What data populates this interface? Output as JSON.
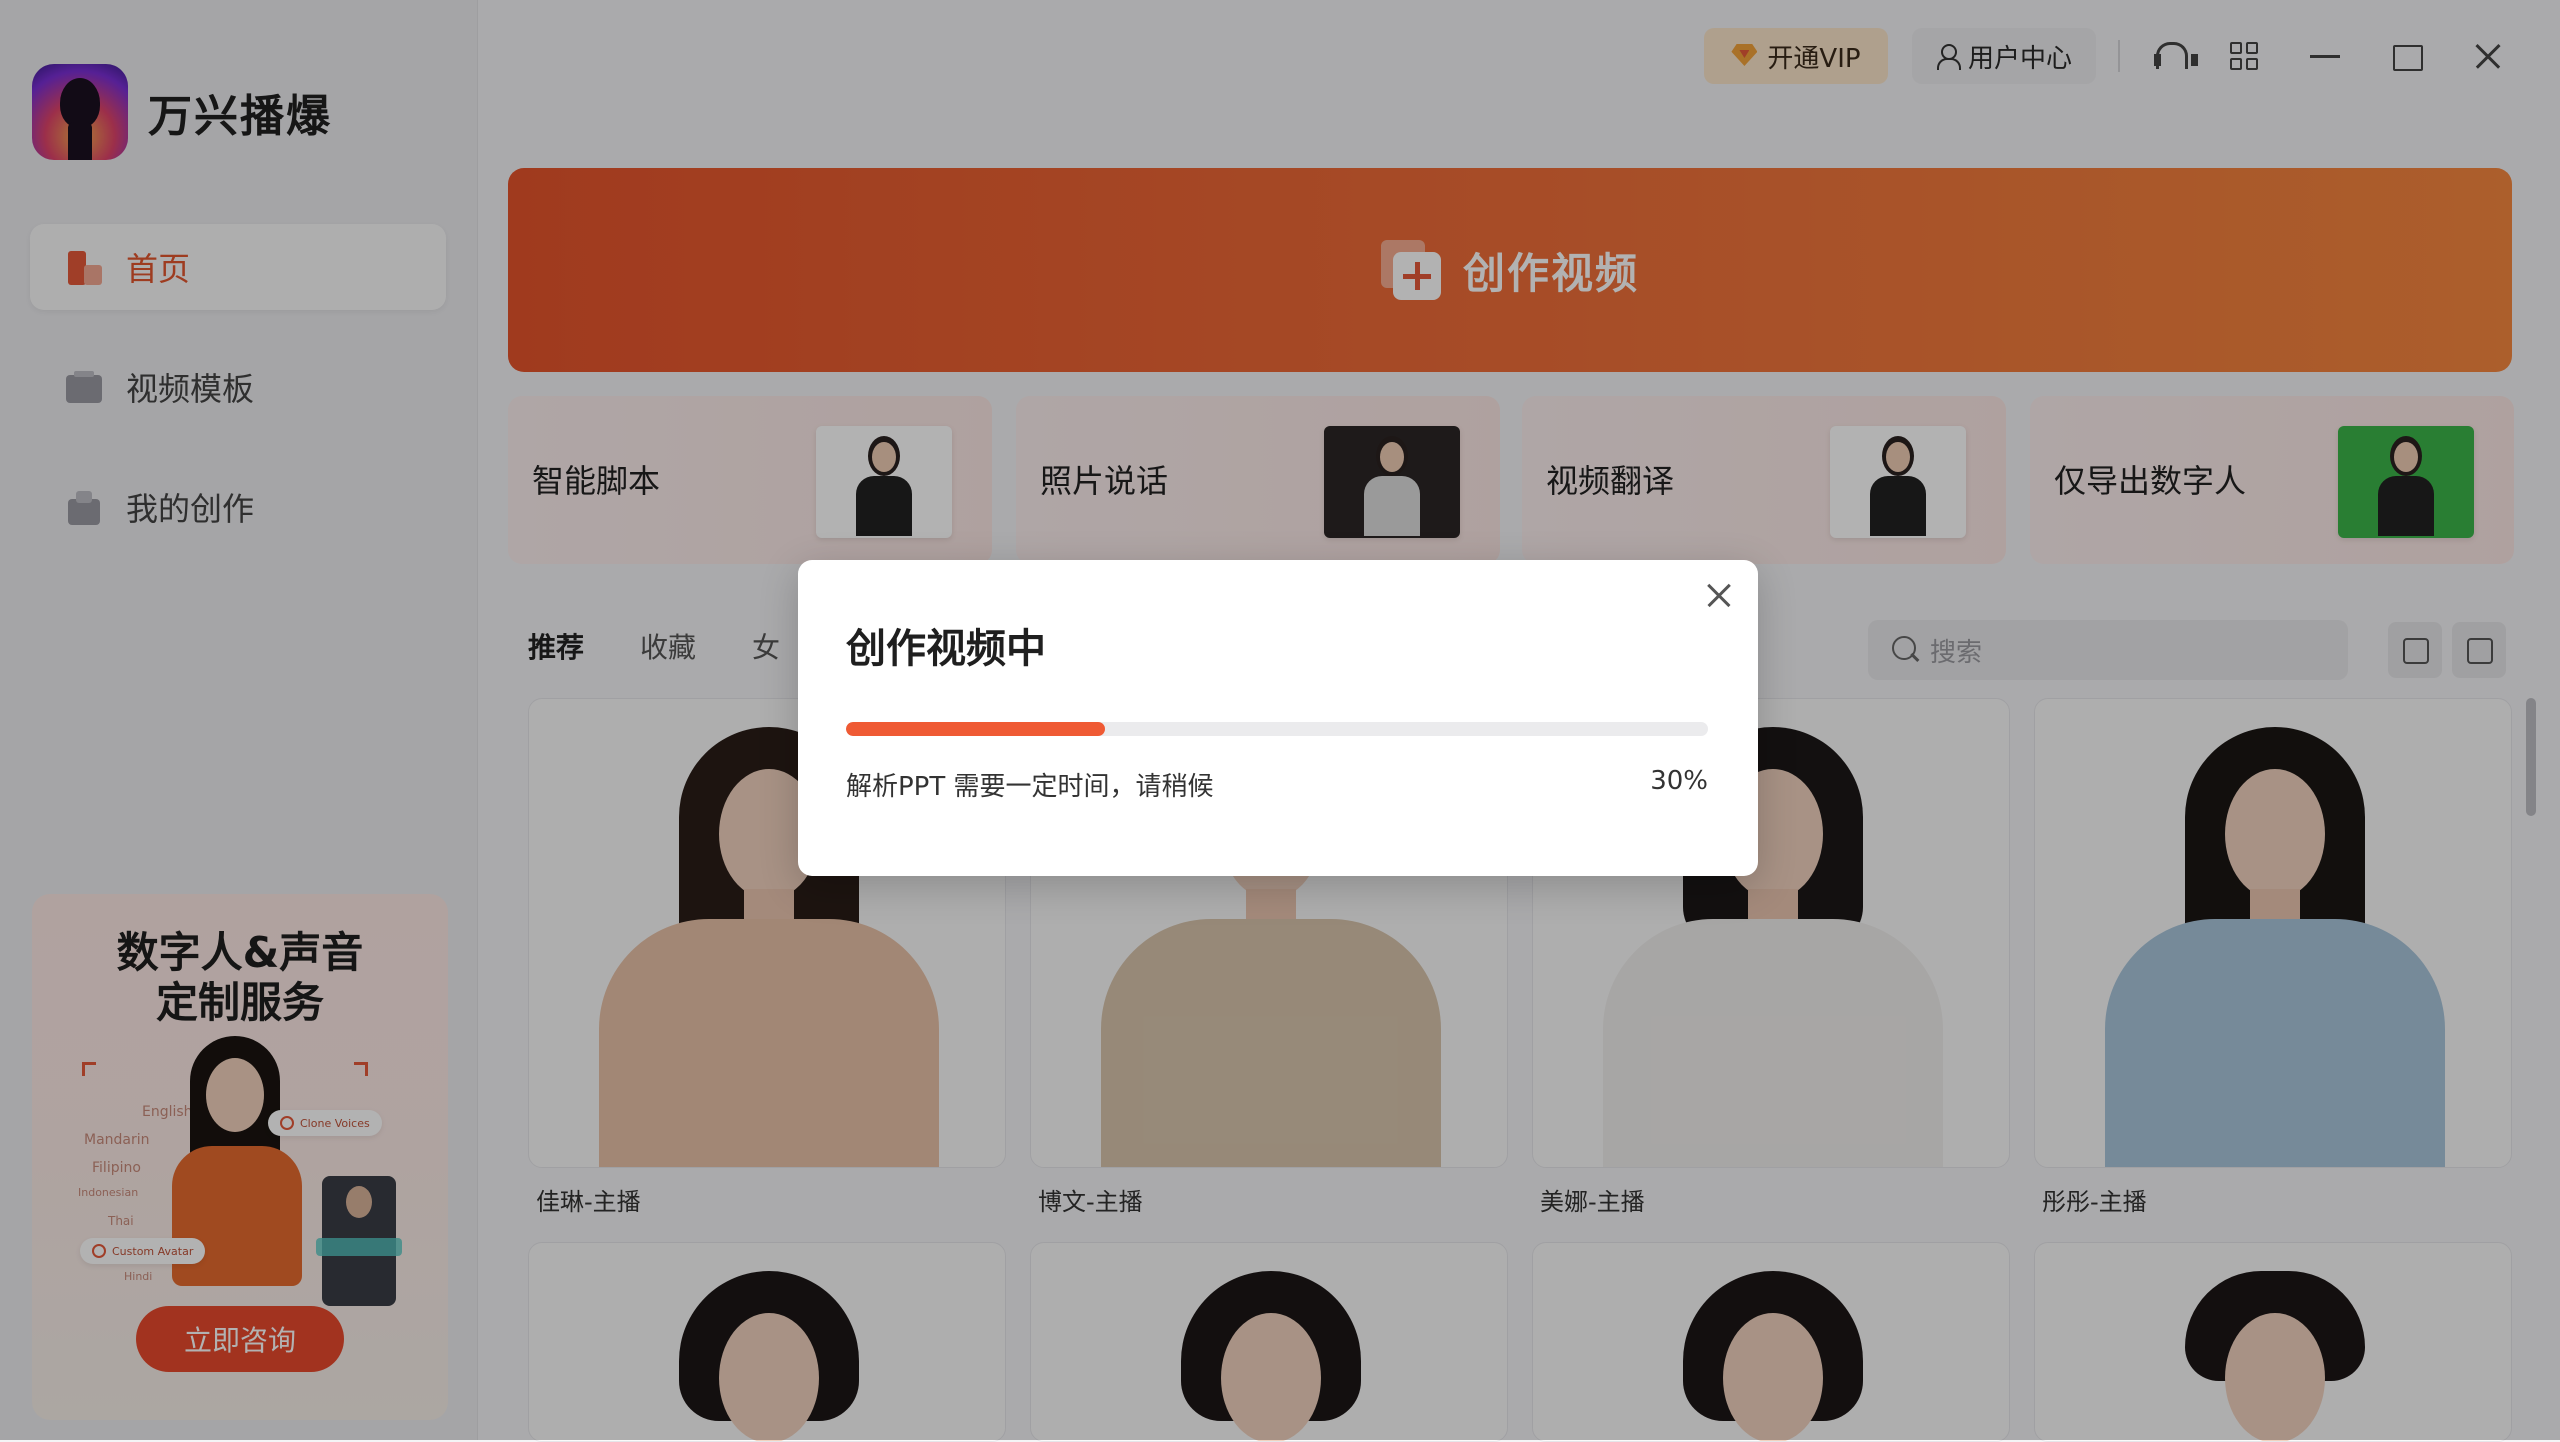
{
  "app": {
    "name": "万兴播爆"
  },
  "sidebar": {
    "items": [
      {
        "label": "首页",
        "icon": "home-icon"
      },
      {
        "label": "视频模板",
        "icon": "template-icon"
      },
      {
        "label": "我的创作",
        "icon": "creation-icon"
      }
    ],
    "promo": {
      "title_line1": "数字人&声音",
      "title_line2": "定制服务",
      "languages": [
        "English",
        "Mandarin",
        "Filipino",
        "Indonesian",
        "Thai",
        "Hindi"
      ],
      "clone_voices_label": "Clone Voices",
      "custom_avatar_label": "Custom Avatar",
      "button": "立即咨询"
    }
  },
  "topbar": {
    "vip_label": "开通VIP",
    "user_center_label": "用户中心"
  },
  "hero": {
    "label": "创作视频"
  },
  "features": [
    {
      "label": "智能脚本"
    },
    {
      "label": "照片说话"
    },
    {
      "label": "视频翻译"
    },
    {
      "label": "仅导出数字人"
    }
  ],
  "tabs": [
    {
      "label": "推荐",
      "active": true
    },
    {
      "label": "收藏",
      "active": false
    },
    {
      "label": "女",
      "active": false
    }
  ],
  "search": {
    "placeholder": "搜索"
  },
  "avatars": [
    {
      "name": "佳琳-主播",
      "hair": "#2a1e18",
      "outfit": "#e8c2a8"
    },
    {
      "name": "博文-主播",
      "hair": "#1e1a18",
      "outfit": "#d8c5ad"
    },
    {
      "name": "美娜-主播",
      "hair": "#1c1818",
      "outfit": "#f0eeec"
    },
    {
      "name": "彤彤-主播",
      "hair": "#1a1614",
      "outfit": "#a9c6dc"
    }
  ],
  "modal": {
    "title": "创作视频中",
    "message": "解析PPT 需要一定时间，请稍候",
    "progress": 0.3,
    "progress_text": "30%"
  },
  "colors": {
    "accent": "#ef5a34",
    "hero_start": "#e6542c",
    "hero_end": "#f6883f",
    "vip_bg": "#fbe6cb"
  }
}
